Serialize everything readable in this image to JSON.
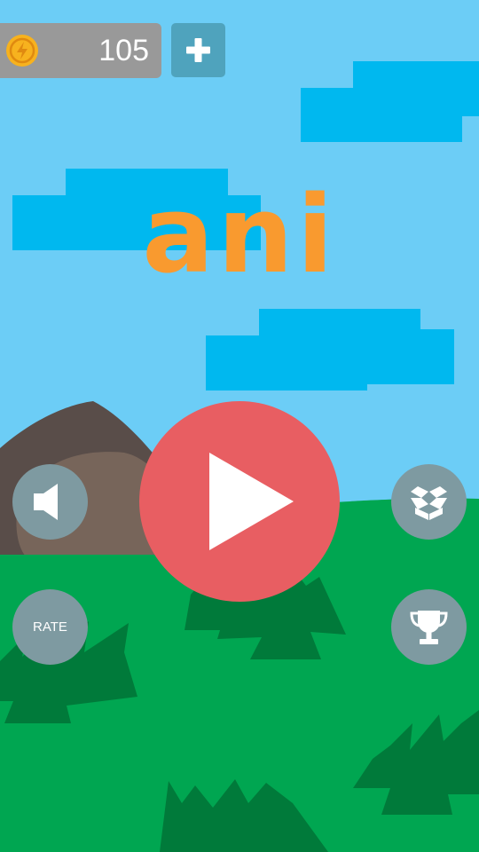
{
  "hud": {
    "coin_icon": "coin-icon",
    "coin_count": "105",
    "add_coins_icon": "plus-icon"
  },
  "title": "ani",
  "menu": {
    "play_icon": "play-icon",
    "sound_icon": "speaker-icon",
    "rate_label": "RATE",
    "box_icon": "dropbox-icon",
    "trophy_icon": "trophy-icon"
  },
  "colors": {
    "sky": "#6ccdf6",
    "cloud": "#00b8ef",
    "grass": "#00a651",
    "grass_dark": "#007a3a",
    "title": "#f99a2f",
    "play_button": "#e85e62",
    "menu_button": "#7e9aa1",
    "coin_bar": "#999999",
    "coin": "#f7b21e"
  }
}
